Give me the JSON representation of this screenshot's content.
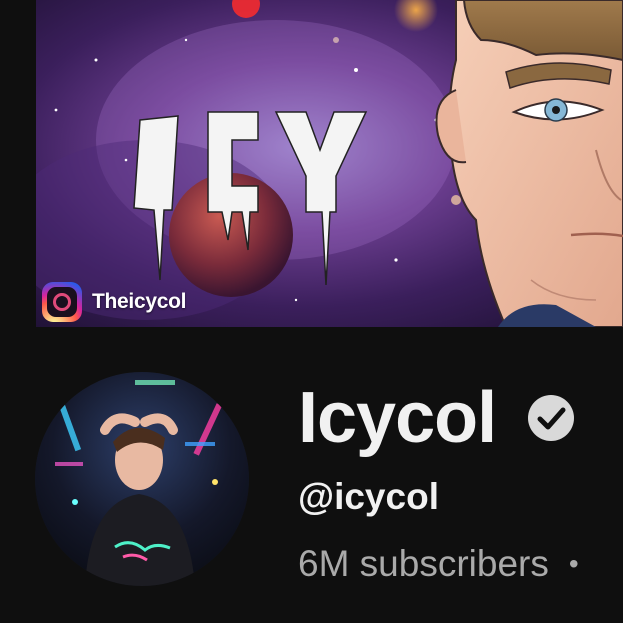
{
  "banner": {
    "logo_text": "ICY",
    "instagram": {
      "icon": "instagram-icon",
      "handle": "Theicycol"
    }
  },
  "channel": {
    "avatar": "channel-avatar",
    "name": "Icycol",
    "verified_icon": "verified-check-icon",
    "handle": "@icycol",
    "subscribers": "6M subscribers",
    "separator": "•"
  },
  "colors": {
    "background": "#0f0f0f",
    "primary_text": "#f1f1f1",
    "secondary_text": "#aaaaaa",
    "verified_badge": "#d9d9d9"
  }
}
